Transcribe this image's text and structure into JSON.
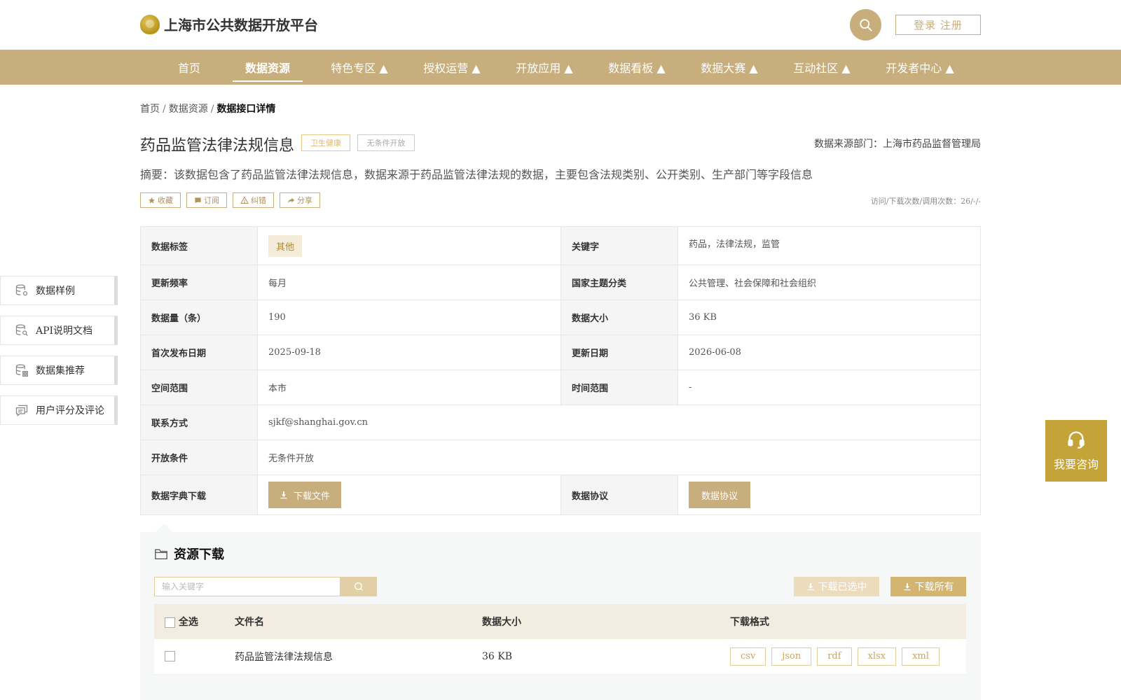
{
  "header": {
    "site_title": "上海市公共数据开放平台",
    "login_label": "登录 注册"
  },
  "nav": [
    {
      "label": "首页"
    },
    {
      "label": "数据资源"
    },
    {
      "label": "特色专区 ▲"
    },
    {
      "label": "授权运营 ▲"
    },
    {
      "label": "开放应用 ▲"
    },
    {
      "label": "数据看板 ▲"
    },
    {
      "label": "数据大赛 ▲"
    },
    {
      "label": "互动社区 ▲"
    },
    {
      "label": "开发者中心 ▲"
    }
  ],
  "breadcrumb": {
    "home": "首页",
    "resources": "数据资源",
    "sep": "/",
    "current": "数据接口详情"
  },
  "dataset": {
    "title": "药品监管法律法规信息",
    "tag_category": "卫生健康",
    "tag_open": "无条件开放",
    "source_dept": "数据来源部门：上海市药品监督管理局",
    "summary": "摘要：该数据包含了药品监管法律法规信息，数据来源于药品监管法律法规的数据，主要包含法规类别、公开类别、生产部门等字段信息",
    "visits": "访问/下载次数/调用次数：26/-/-"
  },
  "actions": {
    "favorite": "收藏",
    "subscribe": "订阅",
    "report": "纠错",
    "share": "分享"
  },
  "info": {
    "tag_label": "数据标签",
    "tag_value": "其他",
    "keyword_label": "关键字",
    "keyword_value": "药品，法律法规，监管",
    "freq_label": "更新频率",
    "freq_value": "每月",
    "theme_label": "国家主题分类",
    "theme_value": "公共管理、社会保障和社会组织",
    "count_label": "数据量（条）",
    "count_value": "190",
    "size_label": "数据大小",
    "size_value": "36 KB",
    "first_pub_label": "首次发布日期",
    "first_pub_value": "2025-09-18",
    "update_label": "更新日期",
    "update_value": "2026-06-08",
    "space_label": "空间范围",
    "space_value": "本市",
    "time_label": "时间范围",
    "time_value": "-",
    "contact_label": "联系方式",
    "contact_value": "sjkf@shanghai.gov.cn",
    "open_label": "开放条件",
    "open_value": "无条件开放",
    "dict_label": "数据字典下载",
    "dict_button": "下载文件",
    "protocol_label": "数据协议",
    "protocol_button": "数据协议"
  },
  "side_menu": [
    {
      "label": "数据样例",
      "icon": "database-gear-icon"
    },
    {
      "label": "API说明文档",
      "icon": "database-search-icon"
    },
    {
      "label": "数据集推荐",
      "icon": "database-grid-icon"
    },
    {
      "label": "用户评分及评论",
      "icon": "comment-icon"
    }
  ],
  "consult_label": "我要咨询",
  "resources": {
    "title": "资源下载",
    "search_placeholder": "输入关键字",
    "download_selected": "下载已选中",
    "download_all": "下载所有",
    "columns": {
      "select_all": "全选",
      "filename": "文件名",
      "size": "数据大小",
      "formats": "下载格式"
    },
    "rows": [
      {
        "filename": "药品监管法律法规信息",
        "size": "36 KB",
        "formats": [
          "csv",
          "json",
          "rdf",
          "xlsx",
          "xml"
        ]
      }
    ]
  },
  "colors": {
    "brand_gold": "#c7ae7c",
    "consult_gold": "#c4a338",
    "panel_bg": "#f6f7f7"
  }
}
